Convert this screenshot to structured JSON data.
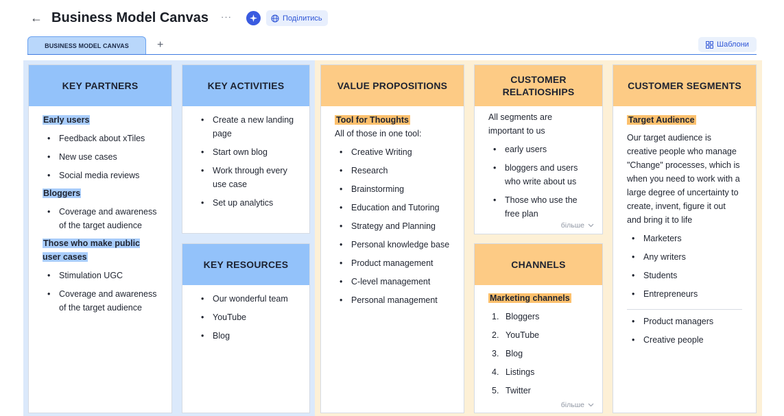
{
  "header": {
    "back_icon": "arrow-left-icon",
    "title": "Business Model Canvas",
    "more_icon": "ellipsis-icon",
    "ai_icon": "sparkle-icon",
    "share_label": "Поділитись"
  },
  "tabs": {
    "active_tab": "BUSINESS MODEL CANVAS",
    "add_icon": "plus-icon",
    "templates_label": "Шаблони"
  },
  "colors": {
    "blue_head": "#93c2fa",
    "orange_head": "#fdcb85",
    "blue_board": "#dbe9fb",
    "orange_board": "#fdf0d6",
    "accent": "#2e55d6"
  },
  "key_partners": {
    "title": "KEY PARTNERS",
    "early_users": "Early users",
    "early_users_items": [
      "Feedback about xTiles",
      "New use cases",
      "Social media reviews"
    ],
    "bloggers": "Bloggers",
    "bloggers_items": [
      "Coverage and awareness of the target audience"
    ],
    "public": "Those who make public user cases",
    "public_items": [
      "Stimulation UGC",
      "Coverage and awareness of the target audience"
    ]
  },
  "key_activities": {
    "title": "KEY ACTIVITIES",
    "items": [
      "Create a new landing page",
      "Start own blog",
      "Work through every use case",
      "Set up analytics"
    ]
  },
  "key_resources": {
    "title": "KEY RESOURCES",
    "items": [
      "Our wonderful team",
      "YouTube",
      "Blog"
    ]
  },
  "value_propositions": {
    "title": "VALUE PROPOSITIONS",
    "highlight": "Tool for Thoughts",
    "intro": "All of those in one tool:",
    "items": [
      "Creative Writing",
      "Research",
      "Brainstorming",
      "Education and Tutoring",
      "Strategy and Planning",
      "Personal knowledge base",
      "Product management",
      "C-level management",
      "Personal management"
    ]
  },
  "customer_relationships": {
    "title": "CUSTOMER RELATIOSHIPS",
    "intro": "All segments are important to us",
    "items": [
      "early users",
      "bloggers and users who write about us",
      "Those who use the free plan"
    ],
    "more_label": "більше"
  },
  "channels": {
    "title": "CHANNELS",
    "highlight": "Marketing channels",
    "items": [
      "Bloggers",
      "YouTube",
      "Blog",
      "Listings",
      "Twitter"
    ],
    "numbers": [
      "1.",
      "2.",
      "3.",
      "4.",
      "5."
    ],
    "more_label": "більше"
  },
  "customer_segments": {
    "title": "CUSTOMER SEGMENTS",
    "highlight": "Target Audience",
    "description": "Our target audience is creative people who manage \"Change\" processes, which is when you need to work with a large degree of uncertainty to create, invent, figure it out and bring it to life",
    "items": [
      "Marketers",
      "Any writers",
      "Students",
      "Entrepreneurs"
    ],
    "items2": [
      "Product managers",
      "Creative people"
    ]
  }
}
